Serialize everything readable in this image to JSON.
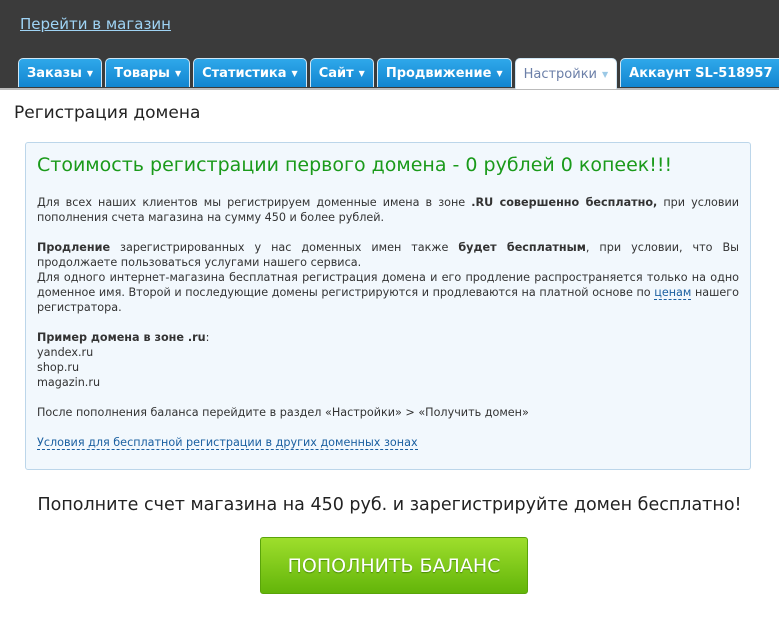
{
  "header": {
    "store_link": "Перейти в магазин"
  },
  "tabs": [
    {
      "label": "Заказы"
    },
    {
      "label": "Товары"
    },
    {
      "label": "Статистика"
    },
    {
      "label": "Сайт"
    },
    {
      "label": "Продвижение"
    },
    {
      "label": "Настройки",
      "active": true
    },
    {
      "label": "Аккаунт SL-518957"
    }
  ],
  "page_title": "Регистрация домена",
  "info": {
    "heading": "Стоимость регистрации первого домена - 0 рублей 0 копеек!!!",
    "p1_a": "Для всех наших клиентов мы регистрируем доменные имена в зоне ",
    "p1_b": ".RU совершенно бесплатно,",
    "p1_c": " при условии пополнения счета магазина на сумму 450 и более рублей.",
    "p2_a": "Продление",
    "p2_b": " зарегистрированных у нас доменных имен также ",
    "p2_c": "будет бесплатным",
    "p2_d": ", при условии, что Вы продолжаете пользоваться услугами нашего сервиса.",
    "p3_a": "Для одного интернет-магазина бесплатная регистрация домена и его продление распространяется только на одно доменное имя. Второй и последующие домены регистрируются и продлеваются на платной основе по ",
    "p3_link": "ценам",
    "p3_b": " нашего регистратора.",
    "example_label": "Пример домена в зоне .ru",
    "example_colon": ":",
    "examples": [
      "yandex.ru",
      "shop.ru",
      "magazin.ru"
    ],
    "after": "После пополнения баланса перейдите в раздел «Настройки» > «Получить домен»",
    "conditions_link": "Условия для бесплатной регистрации в других доменных зонах"
  },
  "cta_text": "Пополните счет магазина на 450 руб. и зарегистрируйте домен бесплатно!",
  "button_label": "ПОПОЛНИТЬ БАЛАНС"
}
